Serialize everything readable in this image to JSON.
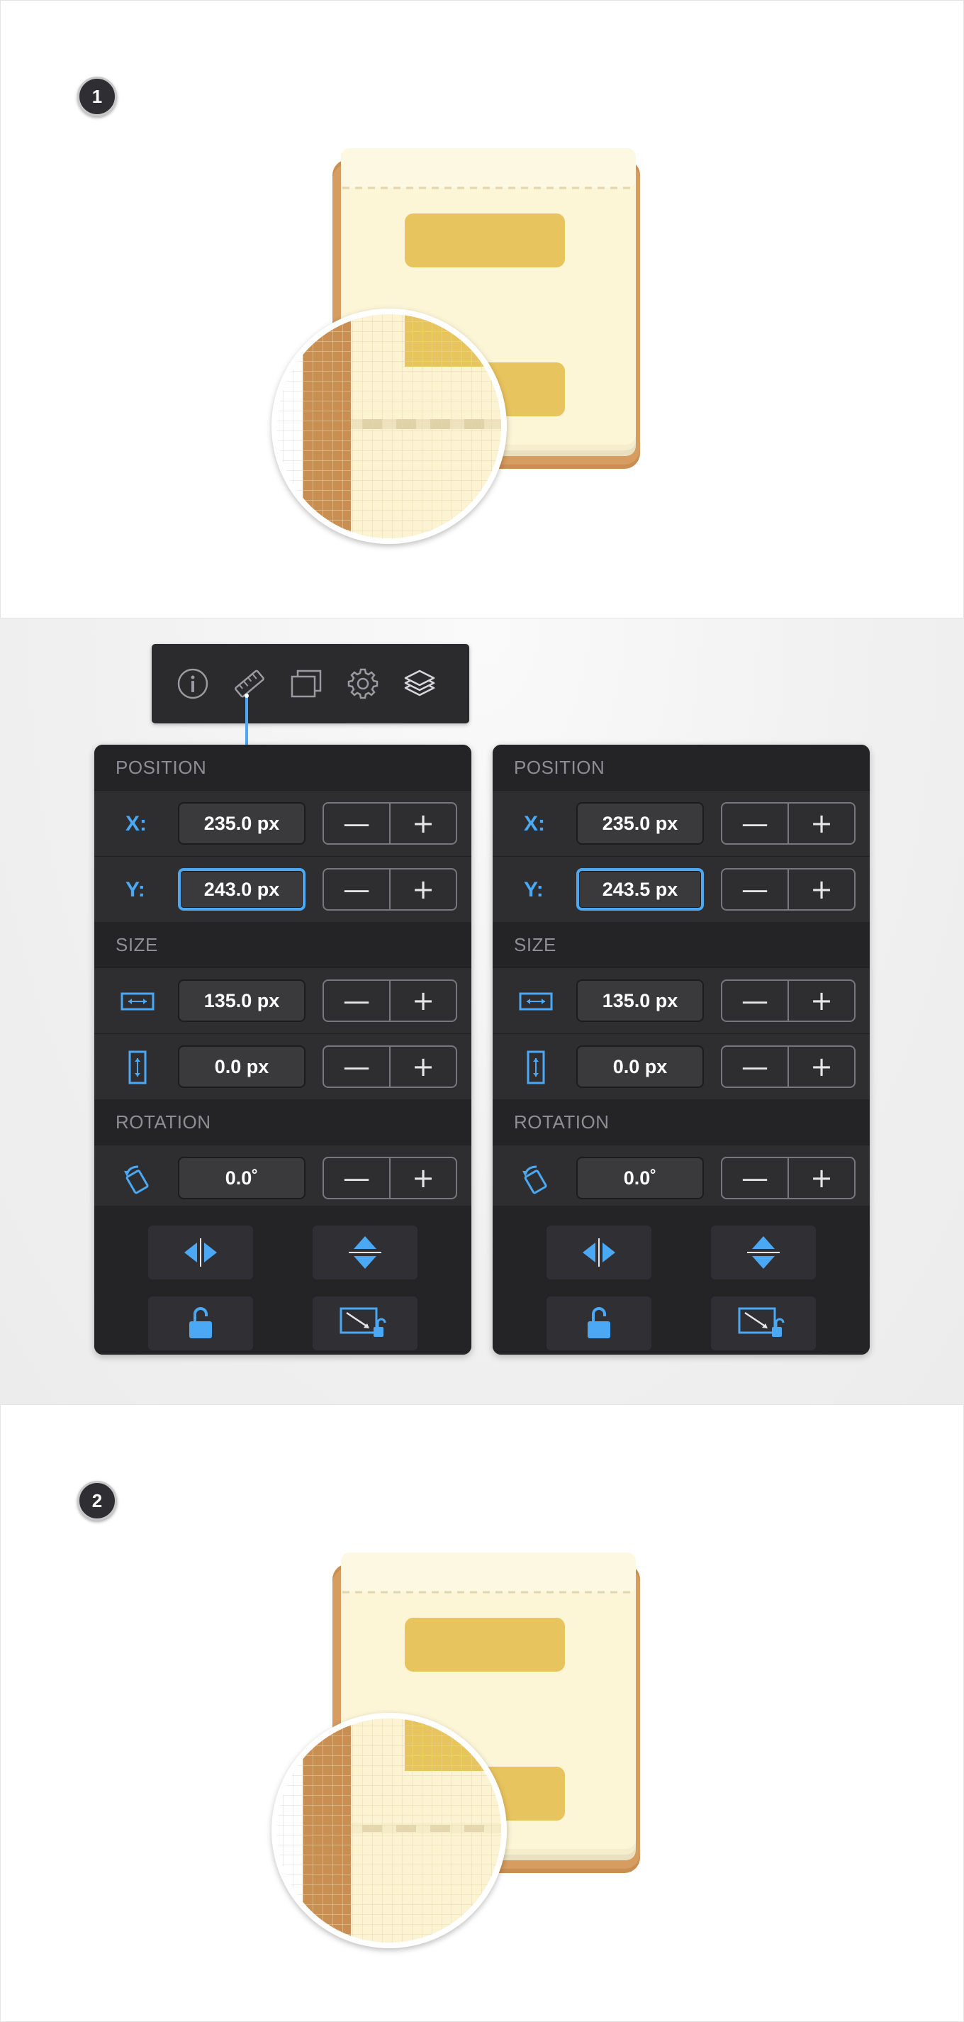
{
  "steps": [
    {
      "number": "1"
    },
    {
      "number": "2"
    }
  ],
  "toolbar": {
    "icons": [
      "info-icon",
      "ruler-icon",
      "artboards-icon",
      "gear-icon",
      "layers-icon"
    ],
    "active": "ruler-icon"
  },
  "colors": {
    "accent": "#4aa8f5",
    "panel_bg": "#242427",
    "row_bg": "#2e2e31",
    "paper": "#fcf5d6",
    "label_yellow": "#e8c45e",
    "cover_brown": "#c98e52"
  },
  "panels": [
    {
      "position_header": "POSITION",
      "x_label": "X:",
      "x_value": "235.0 px",
      "y_label": "Y:",
      "y_value": "243.0 px",
      "size_header": "SIZE",
      "width_value": "135.0 px",
      "height_value": "0.0 px",
      "rotation_header": "ROTATION",
      "rotation_value": "0.0˚"
    },
    {
      "position_header": "POSITION",
      "x_label": "X:",
      "x_value": "235.0 px",
      "y_label": "Y:",
      "y_value": "243.5 px",
      "size_header": "SIZE",
      "width_value": "135.0 px",
      "height_value": "0.0 px",
      "rotation_header": "ROTATION",
      "rotation_value": "0.0˚"
    }
  ],
  "stepper": {
    "minus": "—",
    "plus": "+"
  }
}
